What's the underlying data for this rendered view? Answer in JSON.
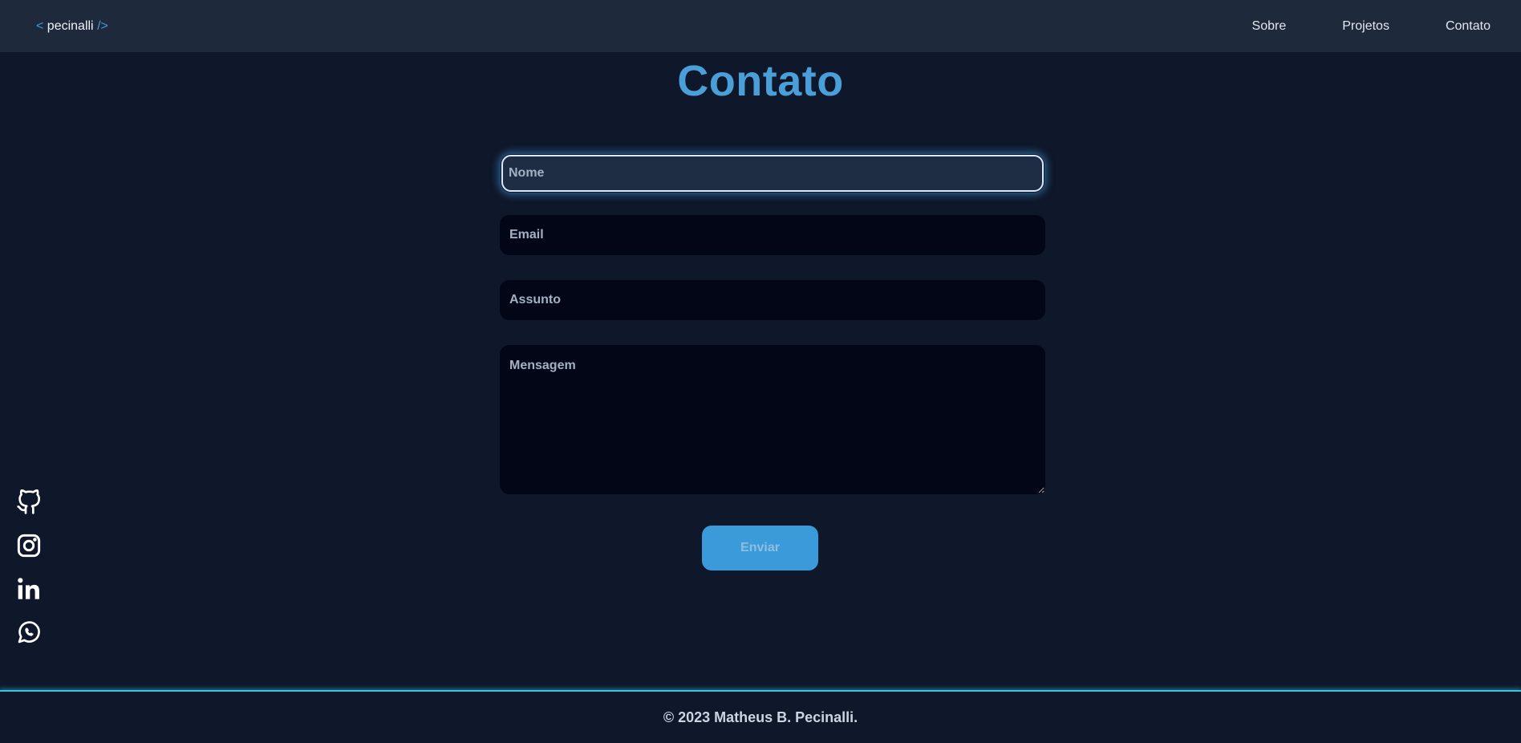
{
  "navbar": {
    "logo_open": "<",
    "logo_name": "pecinalli",
    "logo_close": "/>",
    "links": [
      "Sobre",
      "Projetos",
      "Contato"
    ]
  },
  "contact": {
    "title": "Contato",
    "name_placeholder": "Nome",
    "email_placeholder": "Email",
    "subject_placeholder": "Assunto",
    "message_placeholder": "Mensagem",
    "submit_label": "Enviar"
  },
  "social": {
    "icons": [
      "github-icon",
      "instagram-icon",
      "linkedin-icon",
      "whatsapp-icon"
    ]
  },
  "footer": {
    "text": "© 2023 Matheus B. Pecinalli."
  },
  "colors": {
    "background": "#0f172a",
    "navbar": "#1e293b",
    "accent": "#3b9ad9",
    "footer_line": "#38c6e0"
  }
}
